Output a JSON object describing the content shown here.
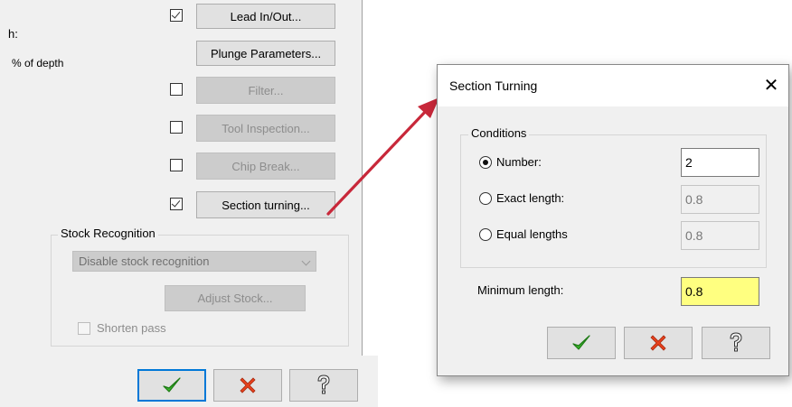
{
  "background_dialog": {
    "partial_label_1": "h:",
    "partial_label_2": "% of depth",
    "lead_in_out_label": "Lead In/Out...",
    "plunge_parameters_label": "Plunge Parameters...",
    "filter_label": "Filter...",
    "tool_inspection_label": "Tool Inspection...",
    "chip_break_label": "Chip Break...",
    "section_turning_label": "Section turning...",
    "stock_recognition": {
      "legend": "Stock Recognition",
      "select_value": "Disable stock recognition",
      "adjust_stock_label": "Adjust Stock...",
      "shorten_pass_label": "Shorten pass"
    }
  },
  "section_turning_dialog": {
    "title": "Section Turning",
    "close_glyph": "✕",
    "conditions": {
      "legend": "Conditions",
      "number_label": "Number:",
      "number_value": "2",
      "exact_length_label": "Exact length:",
      "exact_length_value": "0.8",
      "equal_lengths_label": "Equal lengths",
      "equal_lengths_value": "0.8"
    },
    "minimum_length_label": "Minimum length:",
    "minimum_length_value": "0.8"
  },
  "icons": {
    "ok": "checkmark-icon",
    "cancel": "red-x-icon",
    "help": "question-mark-icon"
  },
  "colors": {
    "ok_green": "#3cb62e",
    "cancel_red": "#e8401c",
    "arrow_red": "#c8283a",
    "highlight_yellow": "#ffff80",
    "focus_blue": "#0078d7"
  }
}
